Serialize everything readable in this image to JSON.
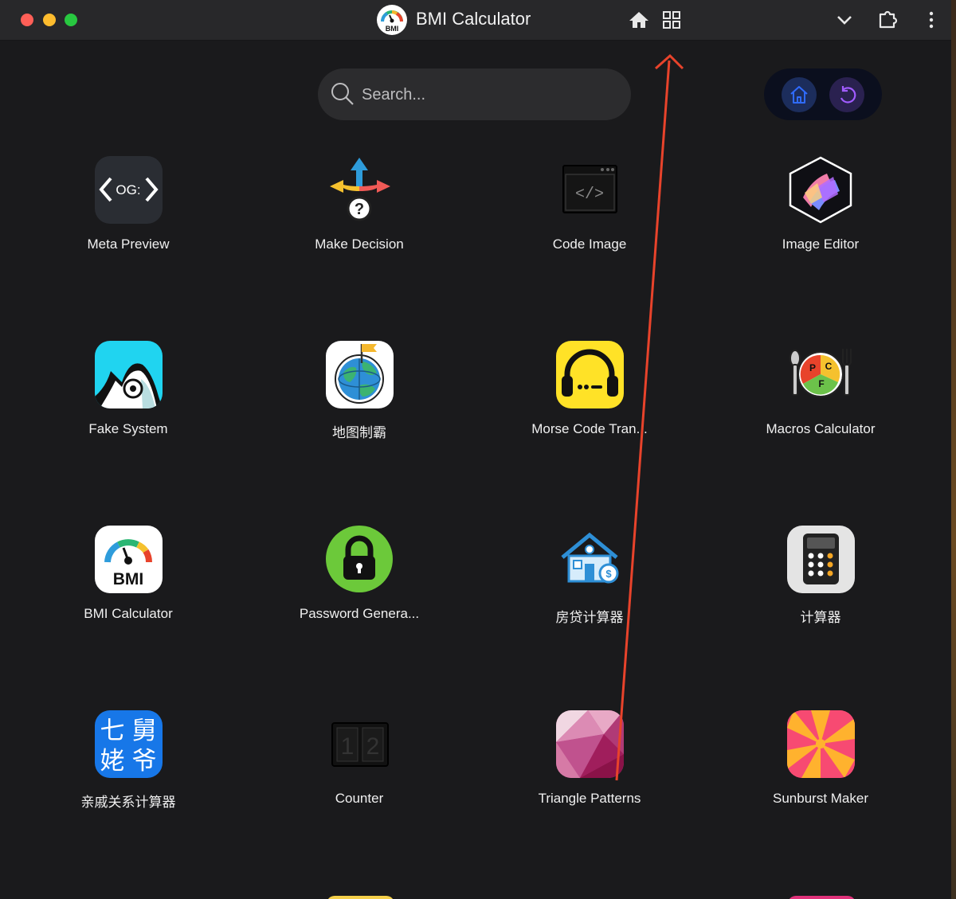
{
  "window": {
    "title": "BMI Calculator",
    "logo_text": "BMI"
  },
  "toolbar": {
    "icons": [
      "home-icon",
      "grid-icon",
      "chevron-down-icon",
      "extension-icon",
      "more-vertical-icon"
    ]
  },
  "search": {
    "placeholder": "Search..."
  },
  "quick_actions": {
    "icons": [
      "home-icon",
      "refresh-icon"
    ],
    "colors": {
      "home": "#2f6bff",
      "refresh": "#a15cff"
    }
  },
  "apps": [
    {
      "label": "Meta Preview",
      "icon": "og-code-icon",
      "icon_text": "OG:"
    },
    {
      "label": "Make Decision",
      "icon": "decision-arrows-icon"
    },
    {
      "label": "Code Image",
      "icon": "code-window-icon",
      "icon_text": "</>"
    },
    {
      "label": "Image Editor",
      "icon": "image-editor-hexagon-icon"
    },
    {
      "label": "Fake System",
      "icon": "fake-system-icon"
    },
    {
      "label": "地图制霸",
      "icon": "globe-flag-icon"
    },
    {
      "label": "Morse Code Tran...",
      "icon": "headphones-icon"
    },
    {
      "label": "Macros Calculator",
      "icon": "macros-plate-icon",
      "icon_text": [
        "P",
        "C",
        "F"
      ]
    },
    {
      "label": "BMI Calculator",
      "icon": "bmi-gauge-icon",
      "icon_text": "BMI"
    },
    {
      "label": "Password Genera...",
      "icon": "padlock-icon"
    },
    {
      "label": "房贷计算器",
      "icon": "house-loan-icon"
    },
    {
      "label": "计算器",
      "icon": "calculator-icon"
    },
    {
      "label": "亲戚关系计算器",
      "icon": "relatives-icon",
      "icon_text": [
        "七",
        "舅",
        "姥",
        "爷"
      ]
    },
    {
      "label": "Counter",
      "icon": "counter-icon",
      "icon_text": "12"
    },
    {
      "label": "Triangle Patterns",
      "icon": "triangle-pattern-icon"
    },
    {
      "label": "Sunburst Maker",
      "icon": "sunburst-icon"
    }
  ],
  "colors": {
    "background": "#1a1a1c",
    "annotation_arrow": "#e8432b"
  }
}
